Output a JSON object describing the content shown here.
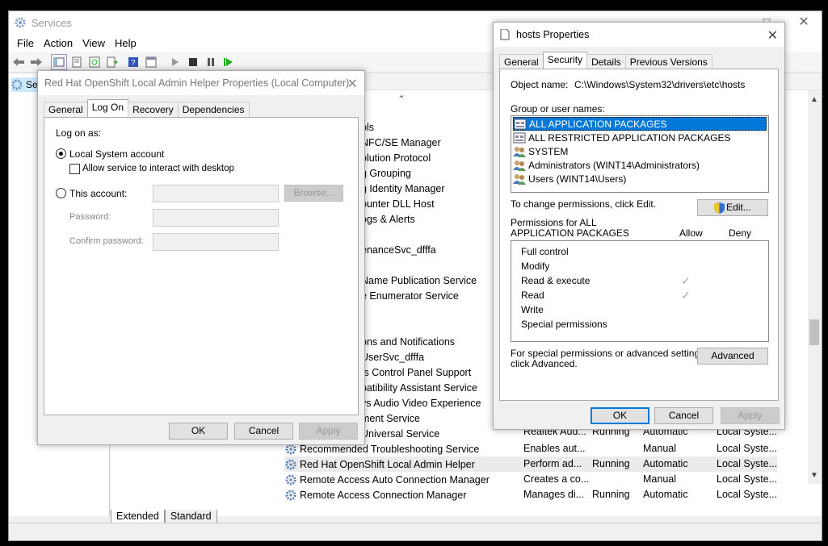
{
  "services_window": {
    "title": "Services",
    "menu": [
      "File",
      "Action",
      "View",
      "Help"
    ],
    "tree_item": "Se",
    "partial_rows": [
      "ols",
      "NFC/SE Manager",
      "olution Protocol",
      "g Grouping",
      "g Identity Manager",
      "ounter DLL Host",
      "ogs & Alerts",
      "",
      "enanceSvc_dfffa",
      "",
      "Name Publication Service",
      "e Enumerator Service",
      "",
      "",
      "ons and Notifications",
      "UserSvc_dfffa",
      "ts Control Panel Support",
      "patibility Assistant Service",
      "vs Audio Video Experience",
      "ment Service",
      "Universal Service"
    ],
    "partial_right": {
      "desc": "Realtek Aud...",
      "status": "Running",
      "startup": "Automatic",
      "logon": "Local Syste..."
    },
    "rows": [
      {
        "name": "Recommended Troubleshooting Service",
        "desc": "Enables aut...",
        "status": "",
        "startup": "Manual",
        "logon": "Local Syste..."
      },
      {
        "name": "Red Hat OpenShift Local Admin Helper",
        "desc": "Perform ad...",
        "status": "Running",
        "startup": "Automatic",
        "logon": "Local Syste..."
      },
      {
        "name": "Remote Access Auto Connection Manager",
        "desc": "Creates a co...",
        "status": "",
        "startup": "Manual",
        "logon": "Local Syste..."
      },
      {
        "name": "Remote Access Connection Manager",
        "desc": "Manages di...",
        "status": "Running",
        "startup": "Automatic",
        "logon": "Local Syste..."
      }
    ],
    "bottom_tabs": [
      "Extended",
      "Standard"
    ]
  },
  "svc_props": {
    "title": "Red Hat OpenShift Local Admin Helper Properties (Local Computer)",
    "tabs": [
      "General",
      "Log On",
      "Recovery",
      "Dependencies"
    ],
    "active_tab": "Log On",
    "log_on_as": "Log on as:",
    "local_system": "Local System account",
    "allow_interact": "Allow service to interact with desktop",
    "this_account": "This account:",
    "browse": "Browse...",
    "password": "Password:",
    "confirm_password": "Confirm password:",
    "ok": "OK",
    "cancel": "Cancel",
    "apply": "Apply"
  },
  "hosts_props": {
    "title": "hosts Properties",
    "tabs": [
      "General",
      "Security",
      "Details",
      "Previous Versions"
    ],
    "active_tab": "Security",
    "object_name_label": "Object name:",
    "object_name": "C:\\Windows\\System32\\drivers\\etc\\hosts",
    "group_label": "Group or user names:",
    "users": [
      "ALL APPLICATION PACKAGES",
      "ALL RESTRICTED APPLICATION PACKAGES",
      "SYSTEM",
      "Administrators (WINT14\\Administrators)",
      "Users (WINT14\\Users)"
    ],
    "change_text": "To change permissions, click Edit.",
    "edit": "Edit...",
    "perm_for": "Permissions for ALL",
    "perm_for2": "APPLICATION PACKAGES",
    "allow": "Allow",
    "deny": "Deny",
    "permissions": [
      {
        "name": "Full control",
        "allow": false
      },
      {
        "name": "Modify",
        "allow": false
      },
      {
        "name": "Read & execute",
        "allow": true
      },
      {
        "name": "Read",
        "allow": true
      },
      {
        "name": "Write",
        "allow": false
      },
      {
        "name": "Special permissions",
        "allow": false
      }
    ],
    "special_text1": "For special permissions or advanced settings,",
    "special_text2": "click Advanced.",
    "advanced": "Advanced",
    "ok": "OK",
    "cancel": "Cancel",
    "apply": "Apply"
  }
}
